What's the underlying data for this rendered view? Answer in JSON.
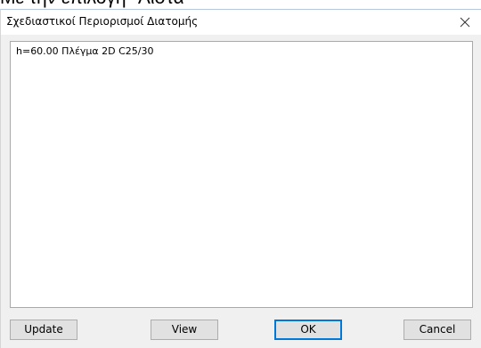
{
  "background": {
    "caption": "Με την επιλογή \"Λίστα\""
  },
  "dialog": {
    "title": "Σχεδιαστικοί Περιορισμοί Διατομής",
    "close_icon": "close-icon",
    "list_items": [
      "h=60.00 Πλέγμα 2D C25/30"
    ],
    "buttons": {
      "update": "Update",
      "view": "View",
      "ok": "OK",
      "cancel": "Cancel"
    }
  },
  "colors": {
    "dialog_bg": "#f0f0f0",
    "button_bg": "#e1e1e1",
    "default_button_border": "#0078d7"
  }
}
